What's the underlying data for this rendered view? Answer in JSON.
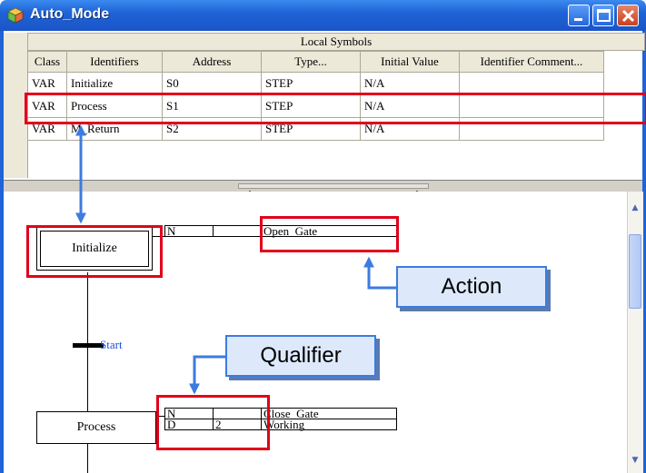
{
  "window": {
    "title": "Auto_Mode"
  },
  "symbols": {
    "header": "Local Symbols",
    "columns": [
      "Class",
      "Identifiers",
      "Address",
      "Type...",
      "Initial Value",
      "Identifier Comment..."
    ],
    "rows": [
      [
        "VAR",
        "Initialize",
        "S0",
        "STEP",
        "N/A",
        ""
      ],
      [
        "VAR",
        "Process",
        "S1",
        "STEP",
        "N/A",
        ""
      ],
      [
        "VAR",
        "M_Return",
        "S2",
        "STEP",
        "N/A",
        ""
      ]
    ]
  },
  "diagram": {
    "initial_step": "Initialize",
    "initial_action": {
      "qualifier": "N",
      "time": "",
      "name": "Open_Gate"
    },
    "transition": "Start",
    "step2": "Process",
    "step2_actions": [
      {
        "qualifier": "N",
        "time": "",
        "name": "Close_Gate"
      },
      {
        "qualifier": "D",
        "time": "2",
        "name": "Working"
      }
    ]
  },
  "callouts": {
    "action": "Action",
    "qualifier": "Qualifier"
  },
  "colors": {
    "highlight": "#e0001a",
    "arrow": "#3c7be0",
    "title_bar": "#1f63d6"
  }
}
